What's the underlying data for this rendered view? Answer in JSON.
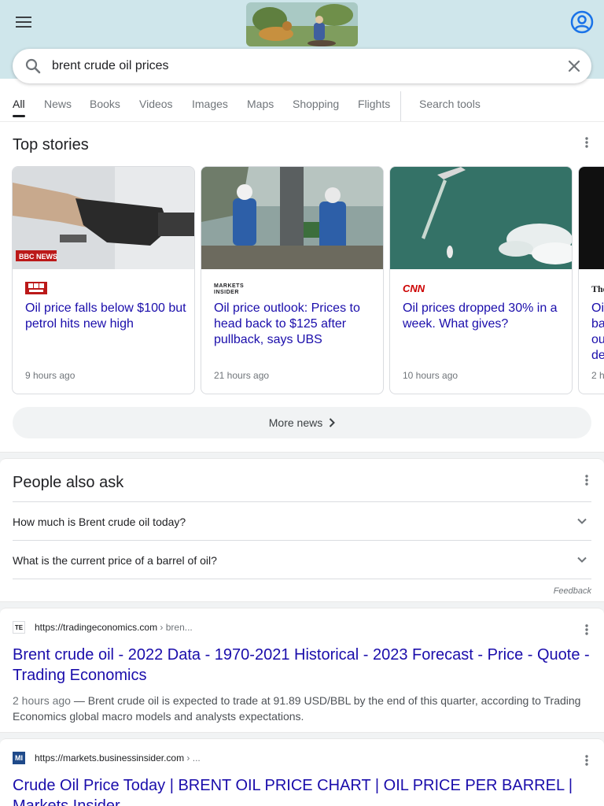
{
  "search": {
    "query": "brent crude oil prices"
  },
  "tabs": [
    "All",
    "News",
    "Books",
    "Videos",
    "Images",
    "Maps",
    "Shopping",
    "Flights"
  ],
  "search_tools": "Search tools",
  "top_stories": {
    "title": "Top stories",
    "stories": [
      {
        "source": "BBC NEWS",
        "title": "Oil price falls below $100 but petrol hits new high",
        "time": "9 hours ago"
      },
      {
        "source": "MARKETS INSIDER",
        "title": "Oil price outlook: Prices to head back to $125 after pullback, says UBS",
        "time": "21 hours ago"
      },
      {
        "source": "CNN",
        "title": "Oil prices dropped 30% in a week. What gives?",
        "time": "10 hours ago"
      },
      {
        "source": "The",
        "title": "Oi ba ou de",
        "time": "2 h"
      }
    ],
    "more_news": "More news"
  },
  "people_also_ask": {
    "title": "People also ask",
    "questions": [
      "How much is Brent crude oil today?",
      "What is the current price of a barrel of oil?"
    ],
    "feedback": "Feedback"
  },
  "results": [
    {
      "favicon": "TE",
      "url": "https://tradingeconomics.com",
      "crumb": " › bren...",
      "title": "Brent crude oil - 2022 Data - 1970-2021 Historical - 2023 Forecast - Price - Quote - Trading Economics",
      "date": "2 hours ago",
      "snippet": " — Brent crude oil is expected to trade at 91.89 USD/BBL by the end of this quarter, according to Trading Economics global macro models and analysts expectations."
    },
    {
      "favicon": "MI",
      "url": "https://markets.businessinsider.com",
      "crumb": " › ...",
      "title": "Crude Oil Price Today | BRENT OIL PRICE CHART | OIL PRICE PER BARREL | Markets Insider"
    }
  ],
  "colors": {
    "link": "#1a0dab",
    "accent": "#1a73e8",
    "header_bg": "#cfe6eb"
  },
  "icons": {
    "menu": "menu-icon",
    "account": "account-icon",
    "search": "search-icon",
    "clear": "close-icon",
    "more": "more-vert-icon",
    "chevron": "chevron-down-icon"
  }
}
